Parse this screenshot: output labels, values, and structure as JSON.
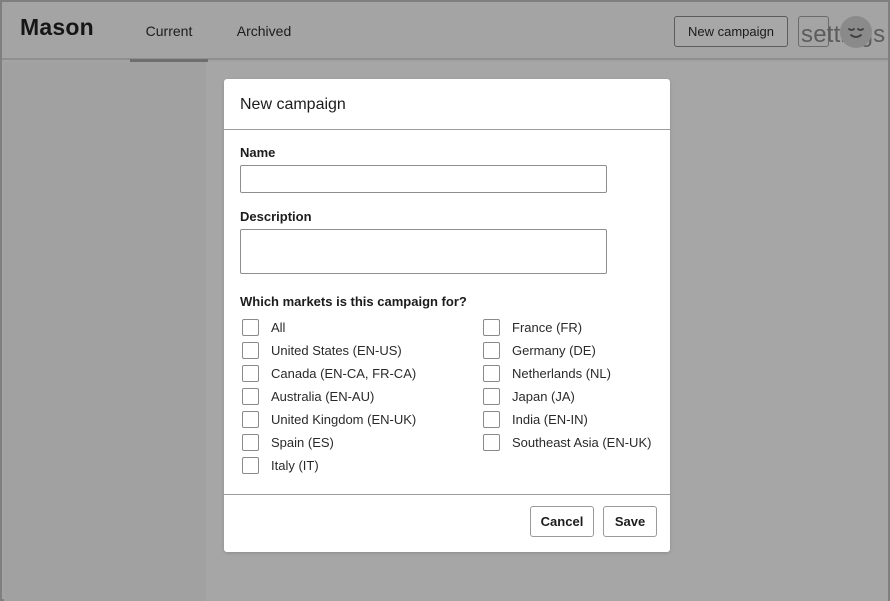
{
  "app": {
    "brand": "Mason"
  },
  "header": {
    "tabs": [
      {
        "label": "Current",
        "active": true
      },
      {
        "label": "Archived",
        "active": false
      }
    ],
    "new_campaign_label": "New campaign",
    "settings_label": "settings",
    "avatar_icon": "user-avatar-icon"
  },
  "modal": {
    "title": "New campaign",
    "name_label": "Name",
    "name_value": "",
    "description_label": "Description",
    "description_value": "",
    "markets_label": "Which markets is this campaign for?",
    "markets_left": [
      {
        "label": "All",
        "checked": false
      },
      {
        "label": "United States (EN-US)",
        "checked": false
      },
      {
        "label": "Canada (EN-CA, FR-CA)",
        "checked": false
      },
      {
        "label": "Australia (EN-AU)",
        "checked": false
      },
      {
        "label": "United Kingdom (EN-UK)",
        "checked": false
      },
      {
        "label": "Spain (ES)",
        "checked": false
      },
      {
        "label": "Italy (IT)",
        "checked": false
      }
    ],
    "markets_right": [
      {
        "label": "France (FR)",
        "checked": false
      },
      {
        "label": "Germany (DE)",
        "checked": false
      },
      {
        "label": "Netherlands (NL)",
        "checked": false
      },
      {
        "label": "Japan (JA)",
        "checked": false
      },
      {
        "label": "India (EN-IN)",
        "checked": false
      },
      {
        "label": "Southeast Asia (EN-UK)",
        "checked": false
      }
    ],
    "cancel_label": "Cancel",
    "save_label": "Save"
  },
  "colors": {
    "overlay": "#a6a6a6",
    "modal_bg": "#ffffff",
    "border": "#8e8e8e"
  }
}
